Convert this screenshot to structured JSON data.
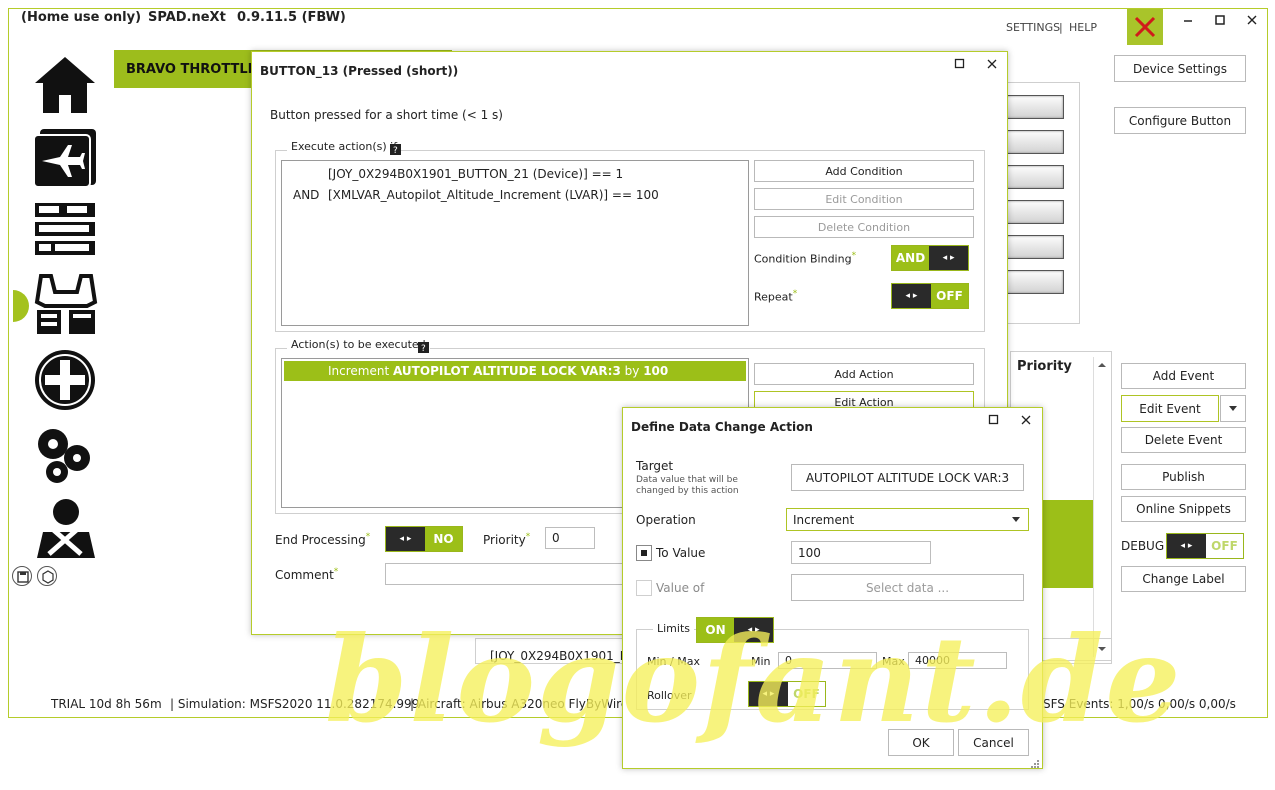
{
  "app": {
    "license": "(Home use only)",
    "name": "SPAD.neXt",
    "version": "0.9.11.5 (FBW)",
    "settings_link": "SETTINGS",
    "help_link": "HELP",
    "separator": "|"
  },
  "sidebar": {
    "icons": [
      "home-icon",
      "aircraft-list-icon",
      "radio-stack-icon",
      "cockpit-icon",
      "add-device-icon",
      "settings-gears-icon",
      "tools-icon"
    ],
    "bottom": [
      "save-icon",
      "package-icon"
    ]
  },
  "main": {
    "device_tab": "BRAVO THROTTLE Q",
    "device_settings": "Device Settings",
    "configure_button": "Configure Button",
    "priority_header": "Priority",
    "bottom_text": "[JOY_0X294B0X1901_BU",
    "events": {
      "add": "Add Event",
      "edit": "Edit Event",
      "delete": "Delete Event",
      "publish": "Publish",
      "online_snippets": "Online Snippets",
      "debug_label": "DEBUG",
      "debug_value": "OFF",
      "change_label": "Change Label"
    }
  },
  "status": {
    "trial": "TRIAL 10d 8h 56m",
    "simulation": "| Simulation: MSFS2020 11.0.282174.999",
    "aircraft": "| Aircraft: Airbus A320neo FlyByWire",
    "events_tail": "SFS  Events: 1,00/s 0,00/s 0,00/s"
  },
  "button_dialog": {
    "title": "BUTTON_13 (Pressed (short))",
    "description": "Button pressed for a short time (< 1 s)",
    "execute_label": "Execute action(s) if",
    "conditions": [
      {
        "op": "",
        "text": "[JOY_0X294B0X1901_BUTTON_21 (Device)] == 1"
      },
      {
        "op": "AND",
        "text": "[XMLVAR_Autopilot_Altitude_Increment (LVAR)] == 100"
      }
    ],
    "add_condition": "Add Condition",
    "edit_condition": "Edit Condition",
    "delete_condition": "Delete Condition",
    "condition_binding_label": "Condition Binding",
    "condition_binding_value": "AND",
    "repeat_label": "Repeat",
    "repeat_value": "OFF",
    "actions_label": "Action(s) to be executed",
    "action_prefix": "Increment",
    "action_target": "AUTOPILOT ALTITUDE LOCK VAR:3",
    "action_by": "by",
    "action_amount": "100",
    "add_action": "Add Action",
    "edit_action": "Edit Action",
    "end_processing_label": "End Processing",
    "end_processing_value": "NO",
    "priority_label": "Priority",
    "priority_value": "0",
    "comment_label": "Comment"
  },
  "data_dialog": {
    "title": "Define Data Change Action",
    "target_label": "Target",
    "target_hint": "Data value that will be changed by this action",
    "target_value": "AUTOPILOT ALTITUDE LOCK VAR:3",
    "operation_label": "Operation",
    "operation_value": "Increment",
    "to_value_label": "To Value",
    "to_value": "100",
    "value_of_label": "Value of",
    "select_data": "Select data ...",
    "limits_label": "Limits",
    "limits_value": "ON",
    "minmax_label": "Min / Max",
    "min_label": "Min",
    "min_value": "0",
    "max_label": "Max",
    "max_value": "40000",
    "rollover_label": "Rollover",
    "rollover_value": "OFF",
    "ok": "OK",
    "cancel": "Cancel"
  },
  "watermark": "blogofant.de",
  "colors": {
    "accent": "#9cbf18",
    "frame": "#b5cc2a",
    "dark": "#2a2a2a",
    "watermark": "#f6f05a"
  }
}
